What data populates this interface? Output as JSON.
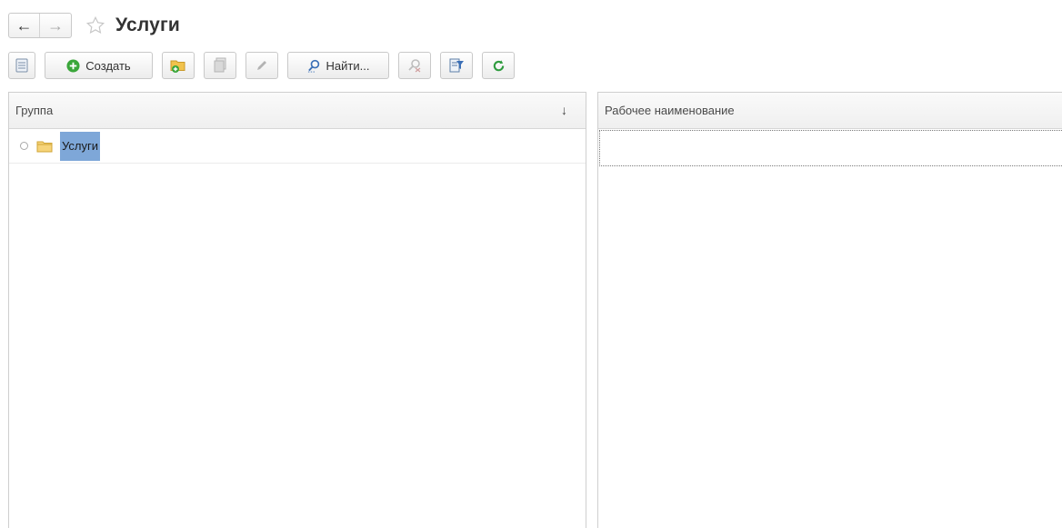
{
  "window": {
    "title": "Услуги"
  },
  "navigation": {
    "back_glyph": "←",
    "forward_glyph": "→"
  },
  "toolbar": {
    "create_label": "Создать",
    "find_label": "Найти..."
  },
  "left_panel": {
    "column_header": "Группа",
    "sort_glyph": "↓",
    "tree_items": [
      {
        "label": "Услуги",
        "icon": "folder-icon",
        "selected": true
      }
    ]
  },
  "right_panel": {
    "column_header": "Рабочее наименование"
  },
  "colors": {
    "selection": "#7ea7d8",
    "create_icon_green": "#3aa63a",
    "refresh_green": "#2e9b3e",
    "folder_yellow": "#f1c24c"
  }
}
